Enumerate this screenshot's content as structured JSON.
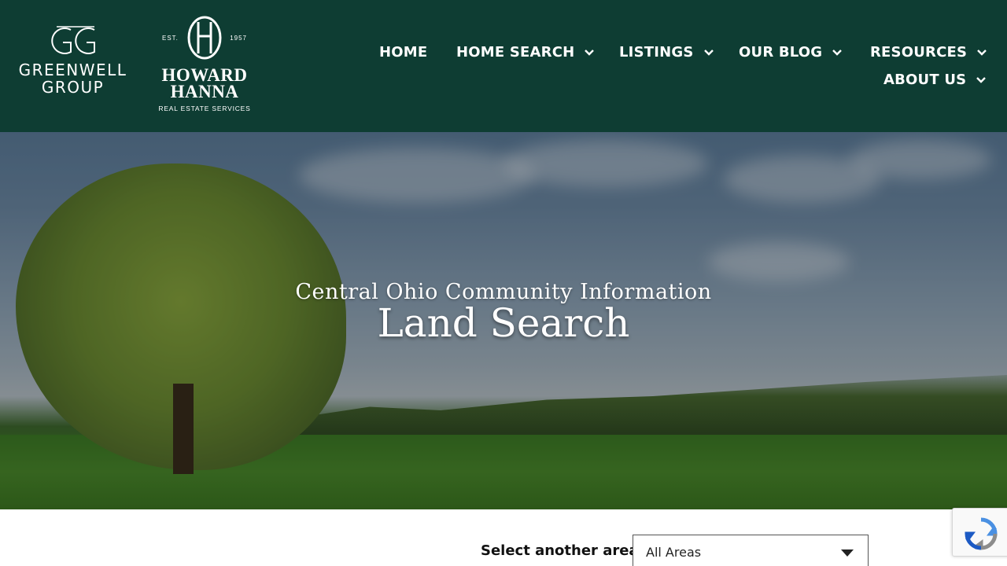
{
  "header": {
    "greenwell_logo": {
      "line1": "GREENWELL",
      "line2": "GROUP"
    },
    "hh_logo": {
      "est": "EST.",
      "year": "1957",
      "name1": "HOWARD",
      "name2": "HANNA",
      "tagline": "REAL ESTATE SERVICES"
    },
    "nav": {
      "home": "HOME",
      "home_search": "HOME SEARCH",
      "listings": "LISTINGS",
      "our_blog": "OUR BLOG",
      "resources": "RESOURCES",
      "about_us": "ABOUT US"
    },
    "background_color": "#0e3d33"
  },
  "hero": {
    "kicker": "Central Ohio Community Information",
    "title": "Land Search"
  },
  "area_filter": {
    "label": "Select another area",
    "selected": "All Areas"
  },
  "icons": {
    "nav_dropdown": "chevron-down-icon",
    "select_caret": "caret-down-icon",
    "recaptcha": "recaptcha-icon"
  }
}
